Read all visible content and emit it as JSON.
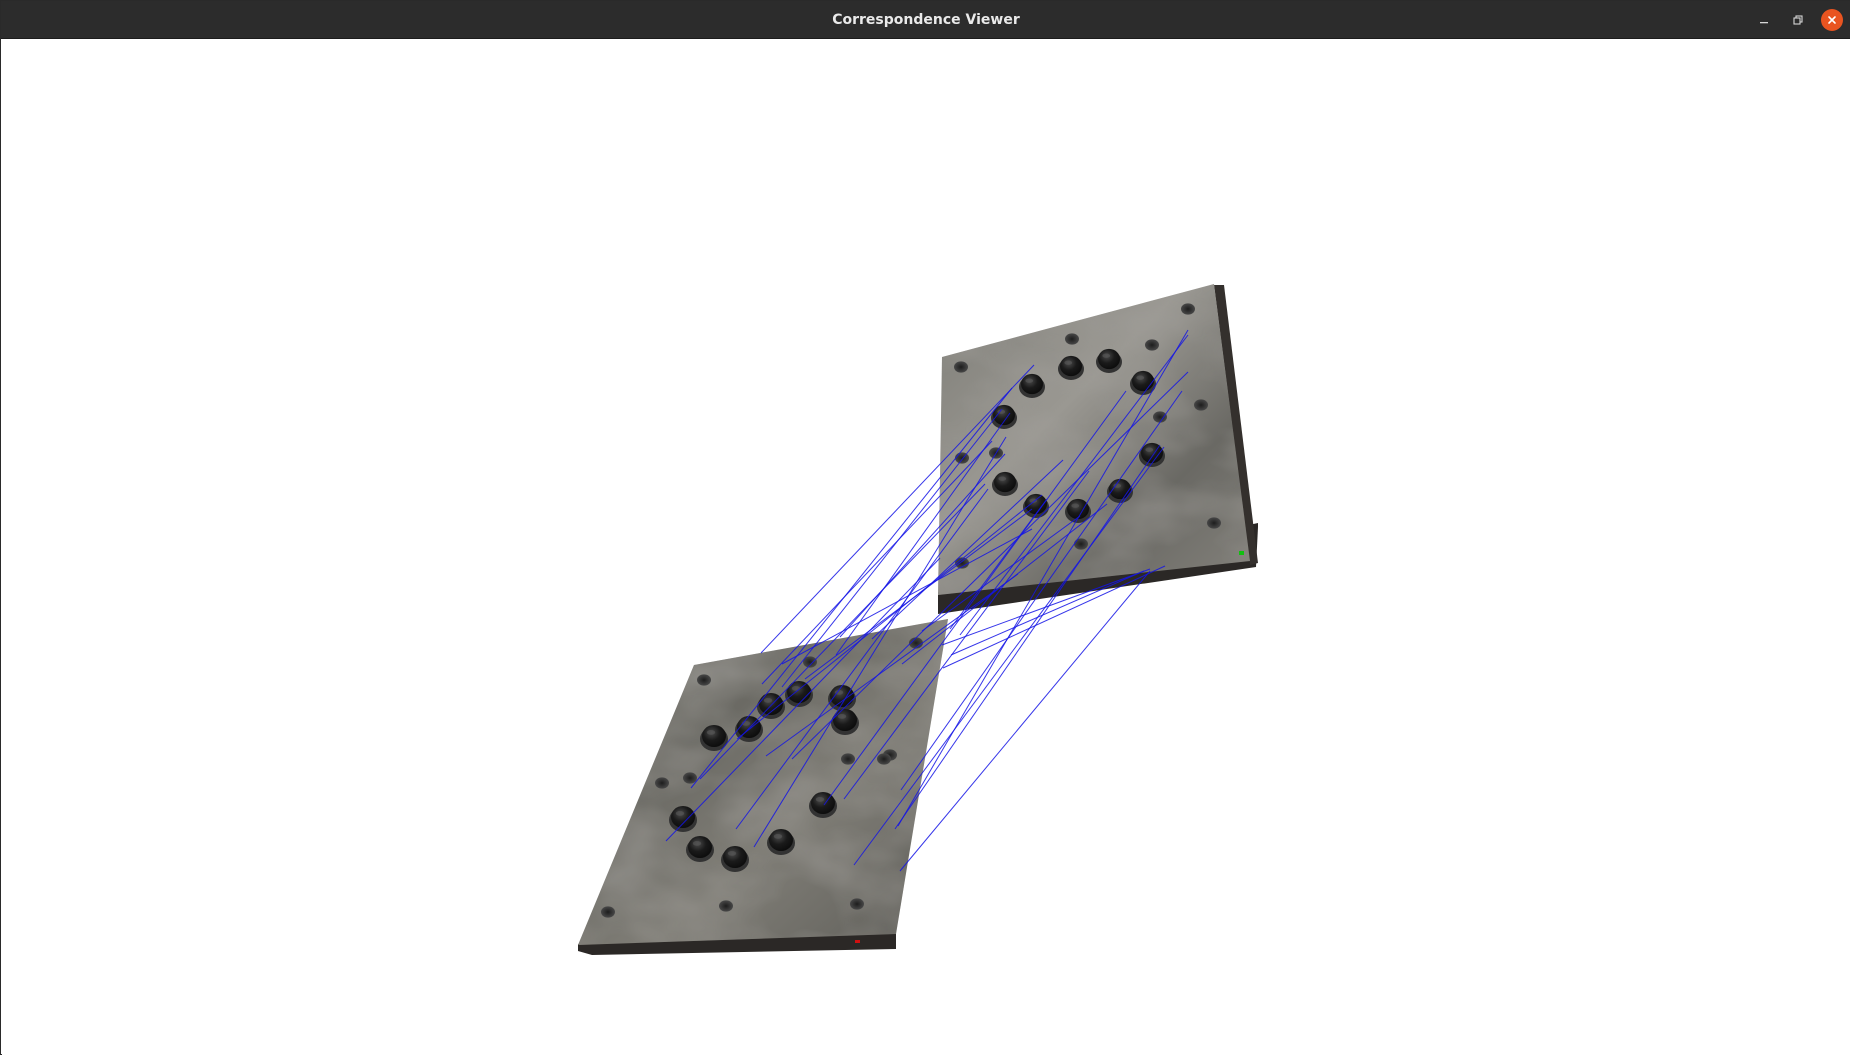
{
  "window": {
    "title": "Correspondence Viewer",
    "controls": {
      "minimize_icon": "minimize-icon",
      "maximize_icon": "restore-icon",
      "close_icon": "close-icon",
      "close_color": "#e95420"
    }
  },
  "scene": {
    "background": "#ffffff",
    "plate_color": "#6e6e68",
    "hole_color": "#141414",
    "edge_color": "#2b2826",
    "correspondence_line_color": "#1414e6",
    "correspondence_count": 30,
    "marker_colors": {
      "source": "#d01010",
      "target": "#10c010"
    }
  }
}
